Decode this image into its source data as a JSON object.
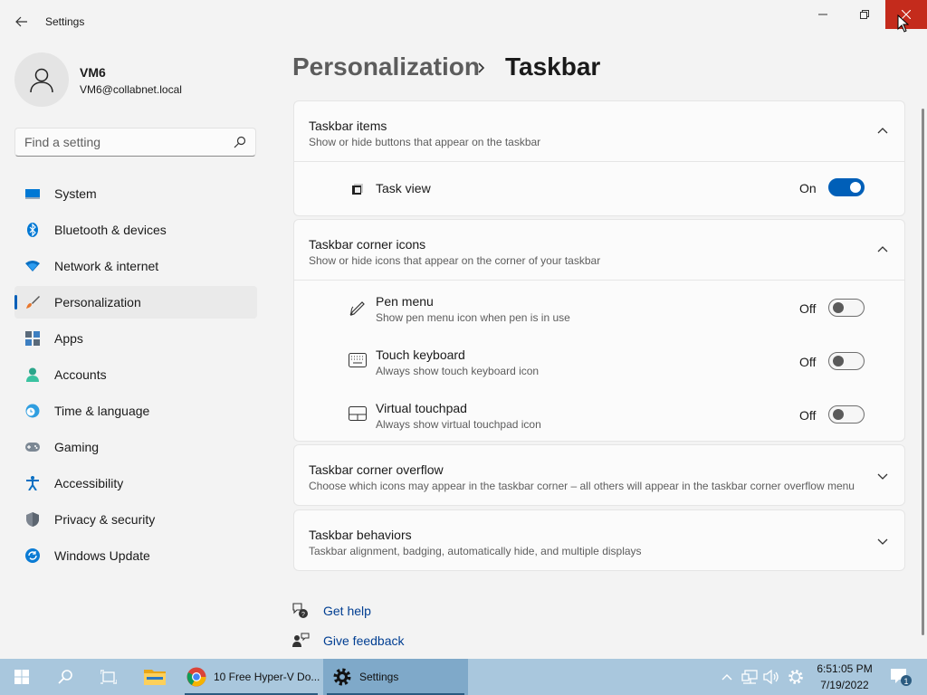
{
  "window": {
    "title": "Settings",
    "controls": {
      "minimize": "minimize",
      "maximize": "maximize",
      "close": "close"
    }
  },
  "profile": {
    "name": "VM6",
    "email": "VM6@collabnet.local"
  },
  "search": {
    "placeholder": "Find a setting"
  },
  "sidebar": {
    "items": [
      {
        "label": "System",
        "icon": "display-icon"
      },
      {
        "label": "Bluetooth & devices",
        "icon": "bluetooth-icon"
      },
      {
        "label": "Network & internet",
        "icon": "wifi-icon"
      },
      {
        "label": "Personalization",
        "icon": "brush-icon",
        "active": true
      },
      {
        "label": "Apps",
        "icon": "apps-icon"
      },
      {
        "label": "Accounts",
        "icon": "person-icon"
      },
      {
        "label": "Time & language",
        "icon": "clock-globe-icon"
      },
      {
        "label": "Gaming",
        "icon": "gamepad-icon"
      },
      {
        "label": "Accessibility",
        "icon": "accessibility-icon"
      },
      {
        "label": "Privacy & security",
        "icon": "shield-icon"
      },
      {
        "label": "Windows Update",
        "icon": "update-icon"
      }
    ]
  },
  "breadcrumb": {
    "parent": "Personalization",
    "current": "Taskbar"
  },
  "sections": {
    "taskbar_items": {
      "title": "Taskbar items",
      "desc": "Show or hide buttons that appear on the taskbar",
      "expanded": true,
      "rows": [
        {
          "title": "Task view",
          "state": "On",
          "on": true,
          "icon": "task-view-icon"
        }
      ]
    },
    "corner_icons": {
      "title": "Taskbar corner icons",
      "desc": "Show or hide icons that appear on the corner of your taskbar",
      "expanded": true,
      "rows": [
        {
          "title": "Pen menu",
          "desc": "Show pen menu icon when pen is in use",
          "state": "Off",
          "on": false,
          "icon": "pen-icon"
        },
        {
          "title": "Touch keyboard",
          "desc": "Always show touch keyboard icon",
          "state": "Off",
          "on": false,
          "icon": "keyboard-icon"
        },
        {
          "title": "Virtual touchpad",
          "desc": "Always show virtual touchpad icon",
          "state": "Off",
          "on": false,
          "icon": "touchpad-icon"
        }
      ]
    },
    "corner_overflow": {
      "title": "Taskbar corner overflow",
      "desc": "Choose which icons may appear in the taskbar corner – all others will appear in the taskbar corner overflow menu",
      "expanded": false
    },
    "behaviors": {
      "title": "Taskbar behaviors",
      "desc": "Taskbar alignment, badging, automatically hide, and multiple displays",
      "expanded": false
    }
  },
  "help": {
    "get_help": "Get help",
    "give_feedback": "Give feedback"
  },
  "taskbar": {
    "apps": [
      {
        "label": "10 Free Hyper-V Do...",
        "icon": "chrome-icon"
      },
      {
        "label": "Settings",
        "icon": "gear-icon",
        "active": true
      }
    ],
    "clock": {
      "time": "6:51:05 PM",
      "date": "7/19/2022"
    },
    "notification_count": "1"
  },
  "colors": {
    "accent": "#005fb8",
    "close_button": "#c42b1c",
    "taskbar": "#a9c7dd"
  }
}
